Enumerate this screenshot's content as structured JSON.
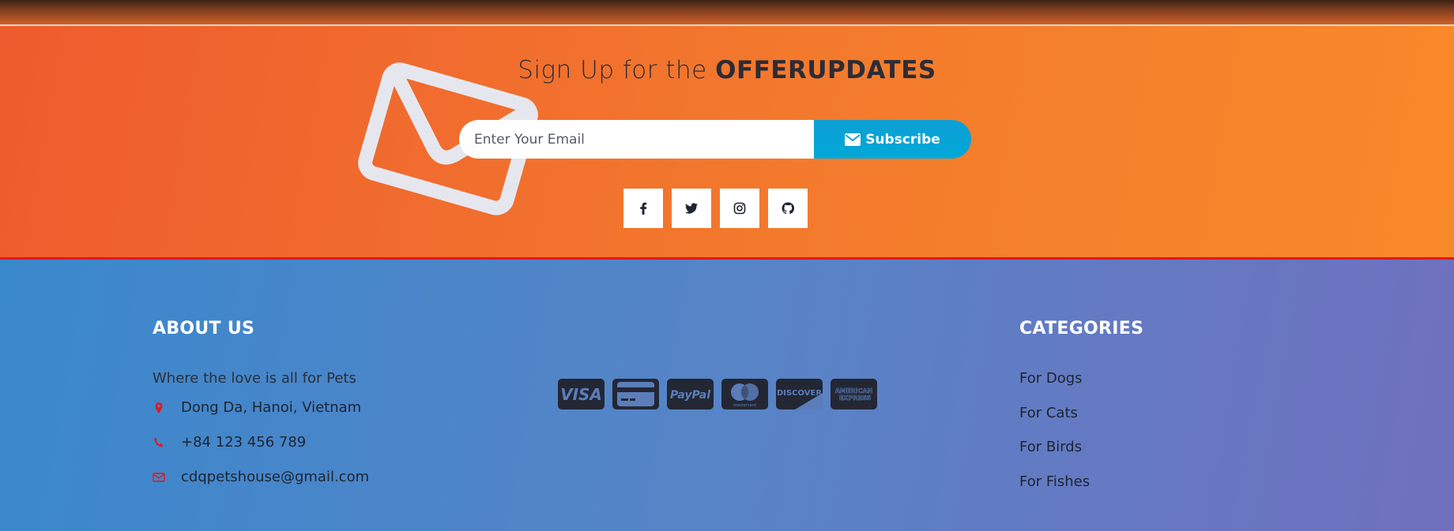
{
  "newsletter": {
    "title_prefix": "Sign Up for the ",
    "title_bold": "OFFERUPDATES",
    "email_placeholder": "Enter Your Email",
    "subscribe_label": "Subscribe",
    "social": [
      {
        "icon": "facebook-icon"
      },
      {
        "icon": "twitter-icon"
      },
      {
        "icon": "instagram-icon"
      },
      {
        "icon": "github-icon"
      }
    ],
    "bg_colors": [
      "#ee5b2e",
      "#f8892a"
    ],
    "subscribe_color": "#00a8d8"
  },
  "about": {
    "heading": "ABOUT US",
    "description": "Where the love is all for Pets",
    "address": "Dong Da, Hanoi, Vietnam",
    "phone": "+84 123 456 789",
    "email": "cdqpetshouse@gmail.com",
    "icon_color": "#e0191f"
  },
  "payments": [
    {
      "name": "visa-card-icon",
      "label": "VISA"
    },
    {
      "name": "credit-card-icon"
    },
    {
      "name": "paypal-card-icon",
      "label": "PayPal"
    },
    {
      "name": "mastercard-card-icon",
      "label": "mastercard"
    },
    {
      "name": "discover-card-icon",
      "label": "DISCOVER"
    },
    {
      "name": "amex-card-icon",
      "label_line1": "AMERICAN",
      "label_line2": "EXPRESS"
    }
  ],
  "categories": {
    "heading": "CATEGORIES",
    "items": [
      "For Dogs",
      "For Cats",
      "For Birds",
      "For Fishes"
    ]
  },
  "footer_colors": [
    "#3a88cc",
    "#7070be"
  ]
}
